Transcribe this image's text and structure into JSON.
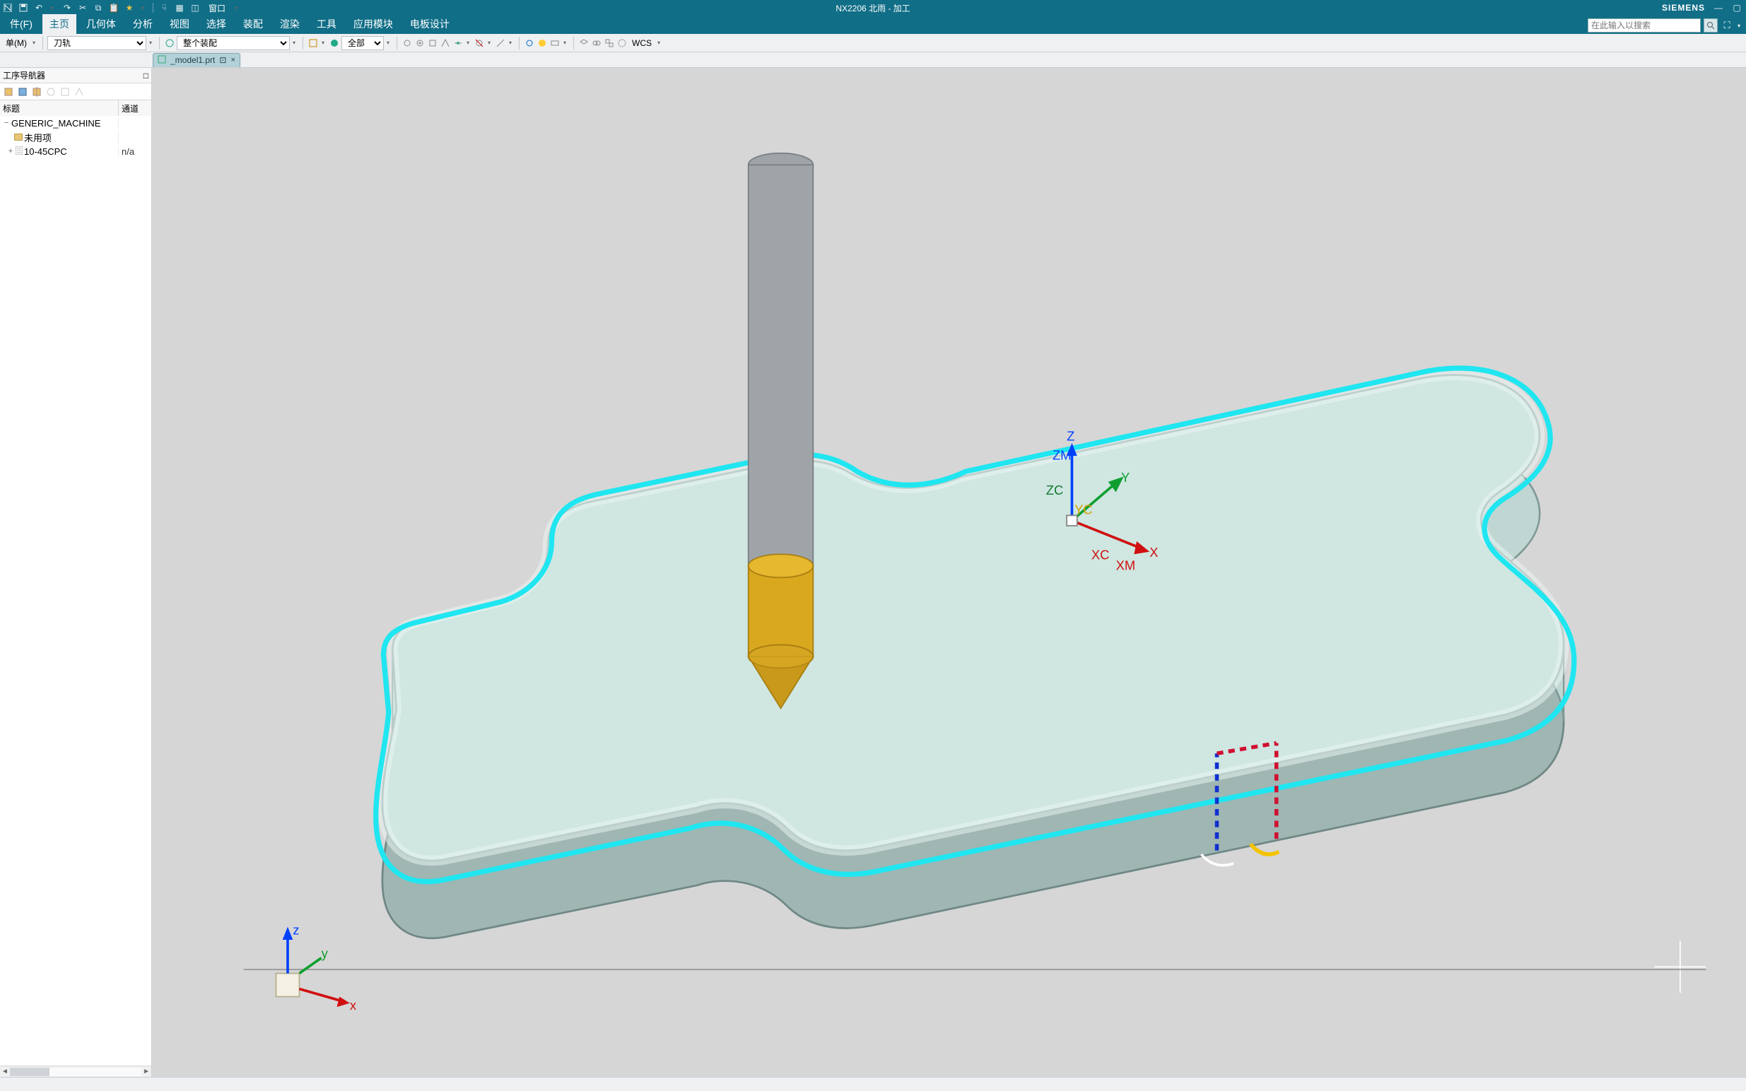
{
  "app": {
    "title": "NX2206 北雨 - 加工",
    "brand": "SIEMENS"
  },
  "qat": {
    "window_label": "窗口"
  },
  "menu": {
    "items": [
      {
        "id": "file",
        "label": "件(F)"
      },
      {
        "id": "home",
        "label": "主页",
        "active": true
      },
      {
        "id": "geometry",
        "label": "几何体"
      },
      {
        "id": "analysis",
        "label": "分析"
      },
      {
        "id": "view",
        "label": "视图"
      },
      {
        "id": "select",
        "label": "选择"
      },
      {
        "id": "assembly",
        "label": "装配"
      },
      {
        "id": "render",
        "label": "渲染"
      },
      {
        "id": "tools",
        "label": "工具"
      },
      {
        "id": "app",
        "label": "应用模块"
      },
      {
        "id": "electrode",
        "label": "电板设计"
      }
    ],
    "search_placeholder": "在此输入以搜索"
  },
  "toolbar": {
    "menu_btn": "单(M)",
    "select1": "刀轨",
    "select2": "整个装配",
    "filter_scope": "全部",
    "wcs_label": "WCS"
  },
  "tabs": {
    "doc": {
      "label": "_model1.prt",
      "pin": "⊡",
      "close": "×"
    }
  },
  "nav": {
    "title": "工序导航器",
    "col1": "标题",
    "col2": "通道",
    "tree": {
      "root": {
        "label": "GENERIC_MACHINE",
        "exp": "−"
      },
      "child1": {
        "label": "未用项"
      },
      "child2": {
        "label": "10-45CPC",
        "exp": "+",
        "chan": "n/a"
      }
    }
  },
  "triad": {
    "z": "Z",
    "zm": "ZM",
    "zc": "ZC",
    "yc": "YC",
    "y": "Y",
    "x": "X",
    "xc": "XC",
    "xm": "XM"
  },
  "mini_triad": {
    "x": "x",
    "y": "y",
    "z": "z"
  }
}
